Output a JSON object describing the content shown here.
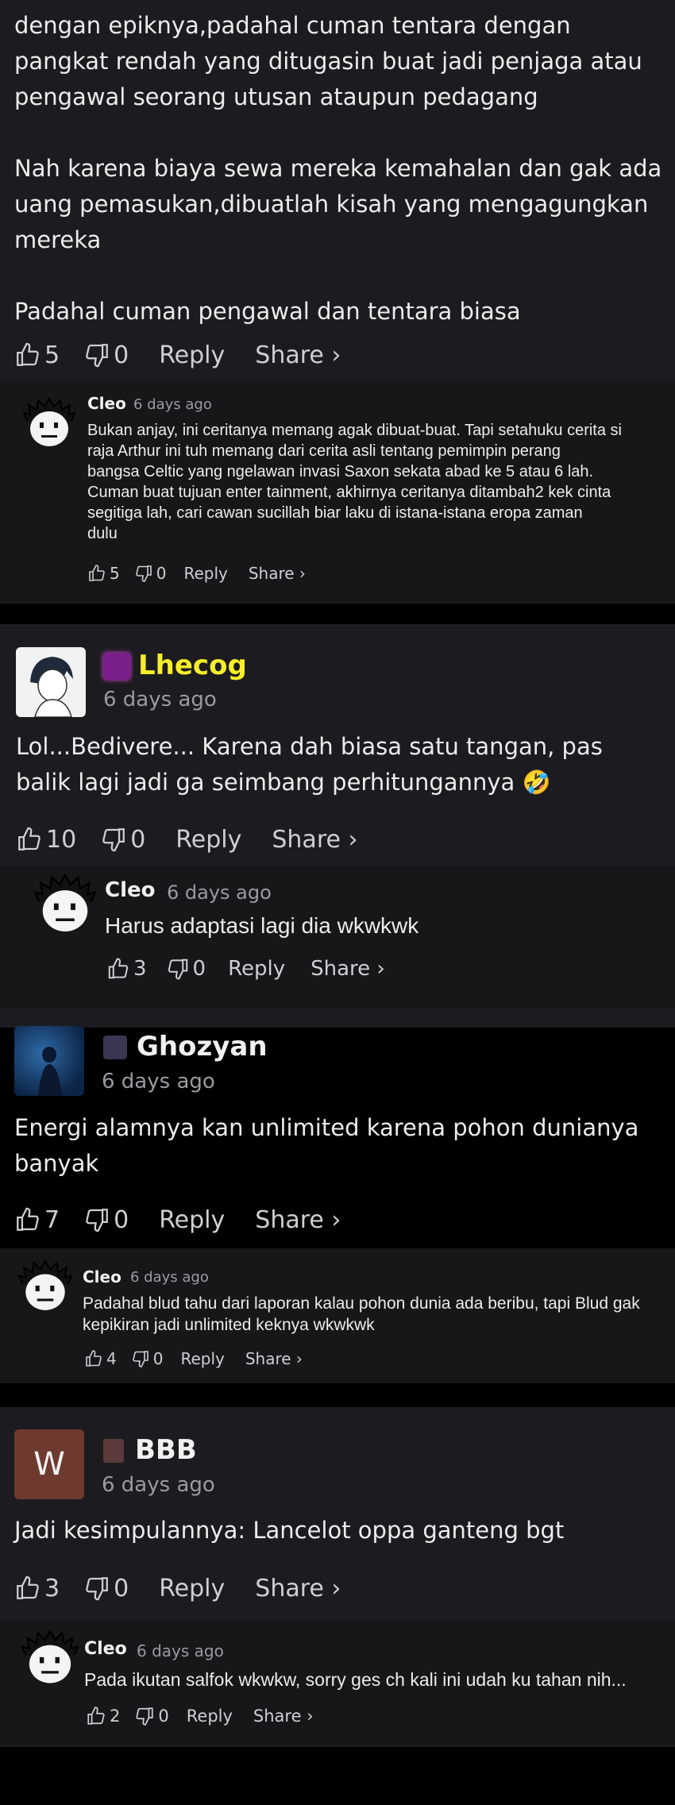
{
  "comment1": {
    "text": "dengan epiknya,padahal cuman tentara dengan\npangkat rendah yang ditugasin buat jadi penjaga atau\npengawal seorang utusan ataupun pedagang\n\nNah karena biaya sewa mereka kemahalan dan gak ada\nuang pemasukan,dibuatlah kisah yang mengagungkan\nmereka\n\nPadahal cuman pengawal dan tentara biasa",
    "likes": "5",
    "dislikes": "0",
    "reply_label": "Reply",
    "share_label": "Share ›"
  },
  "reply1": {
    "user": "Cleo",
    "time": "6 days ago",
    "text": "Bukan anjay, ini ceritanya memang agak dibuat-buat. Tapi setahuku cerita si\nraja Arthur ini tuh memang dari cerita asli tentang pemimpin perang\nbangsa Celtic yang ngelawan invasi Saxon sekata abad ke 5 atau 6 lah.\nCuman buat tujuan enter tainment, akhirnya ceritanya ditambah2 kek cinta\nsegitiga lah, cari cawan sucillah biar laku di istana-istana eropa zaman\ndulu",
    "likes": "5",
    "dislikes": "0",
    "reply_label": "Reply",
    "share_label": "Share ›"
  },
  "comment2": {
    "user": "Lhecog",
    "time": "6 days ago",
    "text": "Lol...Bedivere... Karena dah biasa satu tangan, pas\nbalik lagi jadi ga seimbang perhitungannya 🤣",
    "likes": "10",
    "dislikes": "0",
    "reply_label": "Reply",
    "share_label": "Share ›",
    "name_color": "#f5ee2a"
  },
  "reply2": {
    "user": "Cleo",
    "time": "6 days ago",
    "text": "Harus adaptasi lagi dia wkwkwk",
    "likes": "3",
    "dislikes": "0",
    "reply_label": "Reply",
    "share_label": "Share ›"
  },
  "comment3": {
    "user": "Ghozyan",
    "time": "6 days ago",
    "text": "Energi alamnya kan unlimited karena pohon dunianya\nbanyak",
    "likes": "7",
    "dislikes": "0",
    "reply_label": "Reply",
    "share_label": "Share ›"
  },
  "reply3": {
    "user": "Cleo",
    "time": "6 days ago",
    "text": "Padahal blud tahu dari laporan kalau pohon dunia ada beribu, tapi Blud gak\nkepikiran jadi unlimited keknya wkwkwk",
    "likes": "4",
    "dislikes": "0",
    "reply_label": "Reply",
    "share_label": "Share ›"
  },
  "comment4": {
    "user": "BBB",
    "time": "6 days ago",
    "avatar_letter": "W",
    "text": "Jadi kesimpulannya: Lancelot oppa ganteng bgt",
    "likes": "3",
    "dislikes": "0",
    "reply_label": "Reply",
    "share_label": "Share ›",
    "avatar_color": "#6e3a2f"
  },
  "reply4": {
    "user": "Cleo",
    "time": "6 days ago",
    "text": "Pada ikutan salfok wkwkw, sorry ges ch kali ini udah ku tahan nih...",
    "likes": "2",
    "dislikes": "0",
    "reply_label": "Reply",
    "share_label": "Share ›"
  },
  "icons": [
    "thumbs-up-icon",
    "thumbs-down-icon",
    "badge-icon",
    "cleo-avatar-face"
  ]
}
